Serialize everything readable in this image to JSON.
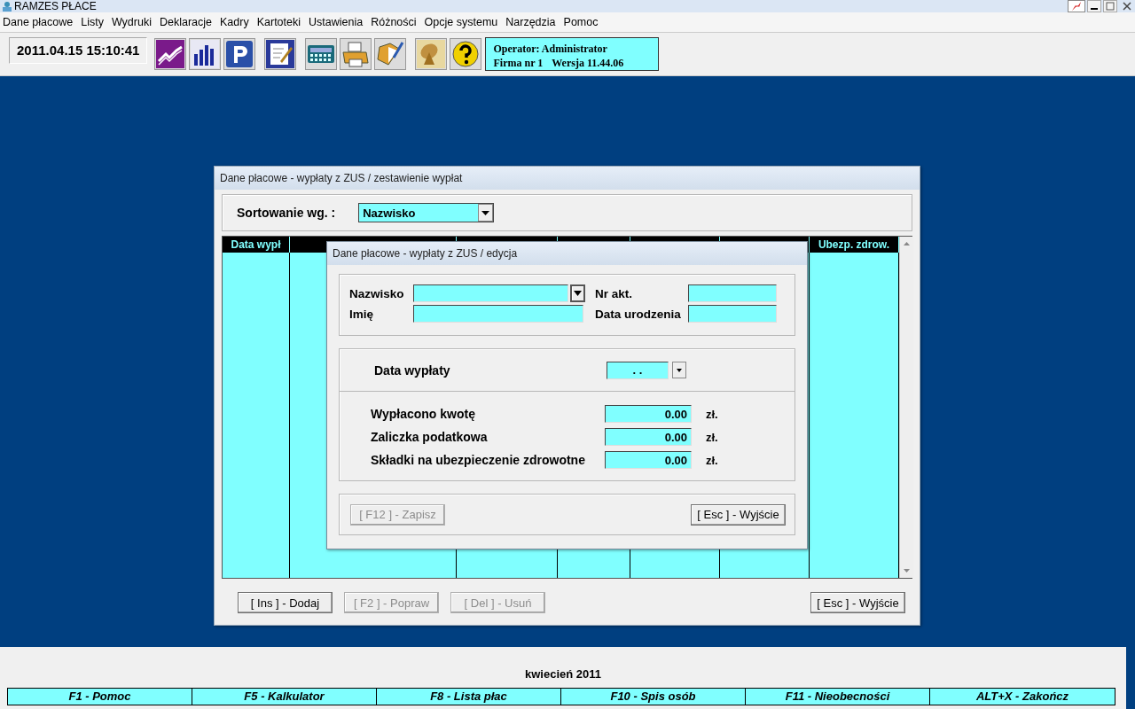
{
  "window": {
    "title": "RAMZES PŁACE"
  },
  "menu": [
    "Dane płacowe",
    "Listy",
    "Wydruki",
    "Deklaracje",
    "Kadry",
    "Kartoteki",
    "Ustawienia",
    "Różności",
    "Opcje systemu",
    "Narzędzia",
    "Pomoc"
  ],
  "toolbar": {
    "clock": "2011.04.15 15:10:41",
    "tool_groups": [
      {
        "tools": [
          {
            "kind": "trend"
          },
          {
            "kind": "bars"
          },
          {
            "kind": "parking"
          }
        ]
      },
      {
        "tools": [
          {
            "kind": "form"
          }
        ]
      },
      {
        "tools": [
          {
            "kind": "calculator"
          },
          {
            "kind": "printer"
          },
          {
            "kind": "notebook"
          }
        ]
      },
      {
        "tools": [
          {
            "kind": "satellite"
          },
          {
            "kind": "help"
          }
        ]
      }
    ],
    "operator": "Operator: Administrator",
    "firm": "Firma nr 1",
    "version": "Wersja 11.44.06"
  },
  "list_dialog": {
    "title": "Dane płacowe - wypłaty z ZUS / zestawienie wypłat",
    "sort_label": "Sortowanie wg. :",
    "sort_value": "Nazwisko",
    "first_column": "Data wypł",
    "last_column": "Ubezp. zdrow.",
    "buttons": [
      {
        "label": "[ Ins ] - Dodaj",
        "disabled": false
      },
      {
        "label": "[ F2 ] - Popraw",
        "disabled": true
      },
      {
        "label": "[ Del ] - Usuń",
        "disabled": true
      }
    ],
    "exit_button": {
      "label": "[ Esc ] - Wyjście",
      "disabled": false
    }
  },
  "edit_dialog": {
    "title": "Dane płacowe - wypłaty z ZUS / edycja",
    "surname_label": "Nazwisko",
    "first_name_label": "Imię",
    "file_no_label": "Nr akt.",
    "birth_label": "Data urodzenia",
    "payout_date_label": "Data wypłaty",
    "payout_date_value": ". .",
    "amounts": [
      {
        "label": "Wypłacono kwotę",
        "value": "0.00",
        "unit": "zł."
      },
      {
        "label": "Zaliczka podatkowa",
        "value": "0.00",
        "unit": "zł."
      },
      {
        "label": "Składki na ubezpieczenie zdrowotne",
        "value": "0.00",
        "unit": "zł."
      }
    ],
    "save_button": {
      "label": "[ F12 ] - Zapisz",
      "disabled": true
    },
    "exit_button": {
      "label": "[ Esc ] - Wyjście",
      "disabled": false
    }
  },
  "footer": {
    "month": "kwiecień 2011",
    "keys": [
      "F1 - Pomoc",
      "F5 - Kalkulator",
      "F8 - Lista płac",
      "F10 - Spis osób",
      "F11 - Nieobecności",
      "ALT+X - Zakończ"
    ]
  }
}
